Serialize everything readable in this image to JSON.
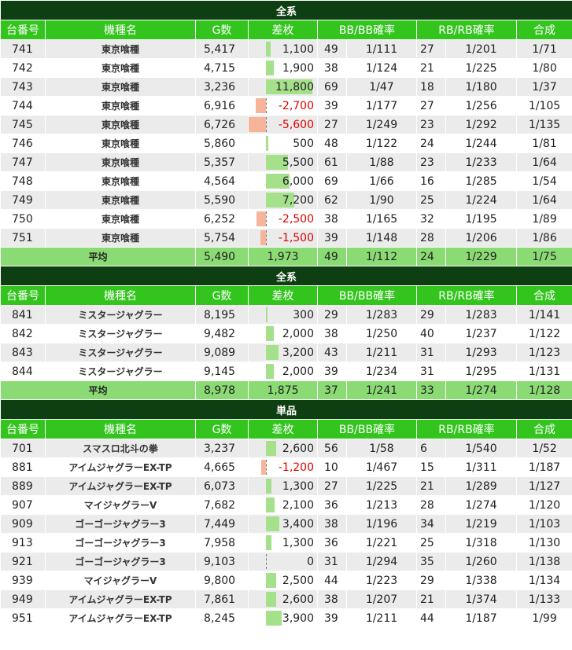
{
  "headers": [
    "台番号",
    "機種名",
    "G数",
    "差枚",
    "BB/BB確率",
    "RB/RB確率",
    "合成"
  ],
  "sections": [
    {
      "title": "全系",
      "rows": [
        {
          "no": "741",
          "name": "東京喰種",
          "games": "5,417",
          "diff": "1,100",
          "diff_value": 1100,
          "bb": "49",
          "bb_rate": "1/111",
          "rb": "27",
          "rb_rate": "1/201",
          "total": "1/71"
        },
        {
          "no": "742",
          "name": "東京喰種",
          "games": "4,715",
          "diff": "1,900",
          "diff_value": 1900,
          "bb": "38",
          "bb_rate": "1/124",
          "rb": "21",
          "rb_rate": "1/225",
          "total": "1/80"
        },
        {
          "no": "743",
          "name": "東京喰種",
          "games": "3,236",
          "diff": "11,800",
          "diff_value": 11800,
          "bb": "69",
          "bb_rate": "1/47",
          "rb": "18",
          "rb_rate": "1/180",
          "total": "1/37"
        },
        {
          "no": "744",
          "name": "東京喰種",
          "games": "6,916",
          "diff": "-2,700",
          "diff_value": -2700,
          "bb": "39",
          "bb_rate": "1/177",
          "rb": "27",
          "rb_rate": "1/256",
          "total": "1/105"
        },
        {
          "no": "745",
          "name": "東京喰種",
          "games": "6,726",
          "diff": "-5,600",
          "diff_value": -5600,
          "bb": "27",
          "bb_rate": "1/249",
          "rb": "23",
          "rb_rate": "1/292",
          "total": "1/135"
        },
        {
          "no": "746",
          "name": "東京喰種",
          "games": "5,860",
          "diff": "500",
          "diff_value": 500,
          "bb": "48",
          "bb_rate": "1/122",
          "rb": "24",
          "rb_rate": "1/244",
          "total": "1/81"
        },
        {
          "no": "747",
          "name": "東京喰種",
          "games": "5,357",
          "diff": "5,500",
          "diff_value": 5500,
          "bb": "61",
          "bb_rate": "1/88",
          "rb": "23",
          "rb_rate": "1/233",
          "total": "1/64"
        },
        {
          "no": "748",
          "name": "東京喰種",
          "games": "4,564",
          "diff": "6,000",
          "diff_value": 6000,
          "bb": "69",
          "bb_rate": "1/66",
          "rb": "16",
          "rb_rate": "1/285",
          "total": "1/54"
        },
        {
          "no": "749",
          "name": "東京喰種",
          "games": "5,590",
          "diff": "7,200",
          "diff_value": 7200,
          "bb": "62",
          "bb_rate": "1/90",
          "rb": "25",
          "rb_rate": "1/224",
          "total": "1/64"
        },
        {
          "no": "750",
          "name": "東京喰種",
          "games": "6,252",
          "diff": "-2,500",
          "diff_value": -2500,
          "bb": "38",
          "bb_rate": "1/165",
          "rb": "32",
          "rb_rate": "1/195",
          "total": "1/89"
        },
        {
          "no": "751",
          "name": "東京喰種",
          "games": "5,754",
          "diff": "-1,500",
          "diff_value": -1500,
          "bb": "39",
          "bb_rate": "1/148",
          "rb": "28",
          "rb_rate": "1/206",
          "total": "1/86"
        }
      ],
      "avg": {
        "label": "平均",
        "games": "5,490",
        "diff": "1,973",
        "bb": "49",
        "bb_rate": "1/112",
        "rb": "24",
        "rb_rate": "1/229",
        "total": "1/75"
      }
    },
    {
      "title": "全系",
      "rows": [
        {
          "no": "841",
          "name": "ミスタージャグラー",
          "games": "8,195",
          "diff": "300",
          "diff_value": 300,
          "bb": "29",
          "bb_rate": "1/283",
          "rb": "29",
          "rb_rate": "1/283",
          "total": "1/141"
        },
        {
          "no": "842",
          "name": "ミスタージャグラー",
          "games": "9,482",
          "diff": "2,000",
          "diff_value": 2000,
          "bb": "38",
          "bb_rate": "1/250",
          "rb": "40",
          "rb_rate": "1/237",
          "total": "1/122"
        },
        {
          "no": "843",
          "name": "ミスタージャグラー",
          "games": "9,089",
          "diff": "3,200",
          "diff_value": 3200,
          "bb": "43",
          "bb_rate": "1/211",
          "rb": "31",
          "rb_rate": "1/293",
          "total": "1/123"
        },
        {
          "no": "844",
          "name": "ミスタージャグラー",
          "games": "9,145",
          "diff": "2,000",
          "diff_value": 2000,
          "bb": "39",
          "bb_rate": "1/234",
          "rb": "31",
          "rb_rate": "1/295",
          "total": "1/131"
        }
      ],
      "avg": {
        "label": "平均",
        "games": "8,978",
        "diff": "1,875",
        "bb": "37",
        "bb_rate": "1/241",
        "rb": "33",
        "rb_rate": "1/274",
        "total": "1/128"
      }
    },
    {
      "title": "単品",
      "rows": [
        {
          "no": "701",
          "name": "スマスロ北斗の拳",
          "games": "3,237",
          "diff": "2,600",
          "diff_value": 2600,
          "bb": "56",
          "bb_rate": "1/58",
          "rb": "6",
          "rb_rate": "1/540",
          "total": "1/52"
        },
        {
          "no": "881",
          "name": "アイムジャグラーEX-TP",
          "games": "4,665",
          "diff": "-1,200",
          "diff_value": -1200,
          "bb": "10",
          "bb_rate": "1/467",
          "rb": "15",
          "rb_rate": "1/311",
          "total": "1/187"
        },
        {
          "no": "889",
          "name": "アイムジャグラーEX-TP",
          "games": "6,073",
          "diff": "1,300",
          "diff_value": 1300,
          "bb": "27",
          "bb_rate": "1/225",
          "rb": "21",
          "rb_rate": "1/289",
          "total": "1/127"
        },
        {
          "no": "907",
          "name": "マイジャグラーV",
          "games": "7,682",
          "diff": "2,100",
          "diff_value": 2100,
          "bb": "36",
          "bb_rate": "1/213",
          "rb": "28",
          "rb_rate": "1/274",
          "total": "1/120"
        },
        {
          "no": "909",
          "name": "ゴーゴージャグラー3",
          "games": "7,449",
          "diff": "3,400",
          "diff_value": 3400,
          "bb": "38",
          "bb_rate": "1/196",
          "rb": "34",
          "rb_rate": "1/219",
          "total": "1/103"
        },
        {
          "no": "913",
          "name": "ゴーゴージャグラー3",
          "games": "7,958",
          "diff": "1,300",
          "diff_value": 1300,
          "bb": "36",
          "bb_rate": "1/221",
          "rb": "25",
          "rb_rate": "1/318",
          "total": "1/130"
        },
        {
          "no": "921",
          "name": "ゴーゴージャグラー3",
          "games": "9,103",
          "diff": "0",
          "diff_value": 0,
          "bb": "31",
          "bb_rate": "1/294",
          "rb": "35",
          "rb_rate": "1/260",
          "total": "1/138"
        },
        {
          "no": "939",
          "name": "マイジャグラーV",
          "games": "9,800",
          "diff": "2,500",
          "diff_value": 2500,
          "bb": "44",
          "bb_rate": "1/223",
          "rb": "29",
          "rb_rate": "1/338",
          "total": "1/134"
        },
        {
          "no": "949",
          "name": "アイムジャグラーEX-TP",
          "games": "7,861",
          "diff": "2,600",
          "diff_value": 2600,
          "bb": "38",
          "bb_rate": "1/207",
          "rb": "21",
          "rb_rate": "1/374",
          "total": "1/133"
        },
        {
          "no": "951",
          "name": "アイムジャグラーEX-TP",
          "games": "8,245",
          "diff": "3,900",
          "diff_value": 3900,
          "bb": "39",
          "bb_rate": "1/211",
          "rb": "44",
          "rb_rate": "1/187",
          "total": "1/99"
        }
      ]
    }
  ],
  "colors": {
    "title_bg": "#0e3f12",
    "header_bg": "#33c51e",
    "avg_bg": "#8bdb74",
    "bar_pos": "#a5e08a",
    "bar_neg": "#f6b59a",
    "neg_text": "#e00000"
  }
}
